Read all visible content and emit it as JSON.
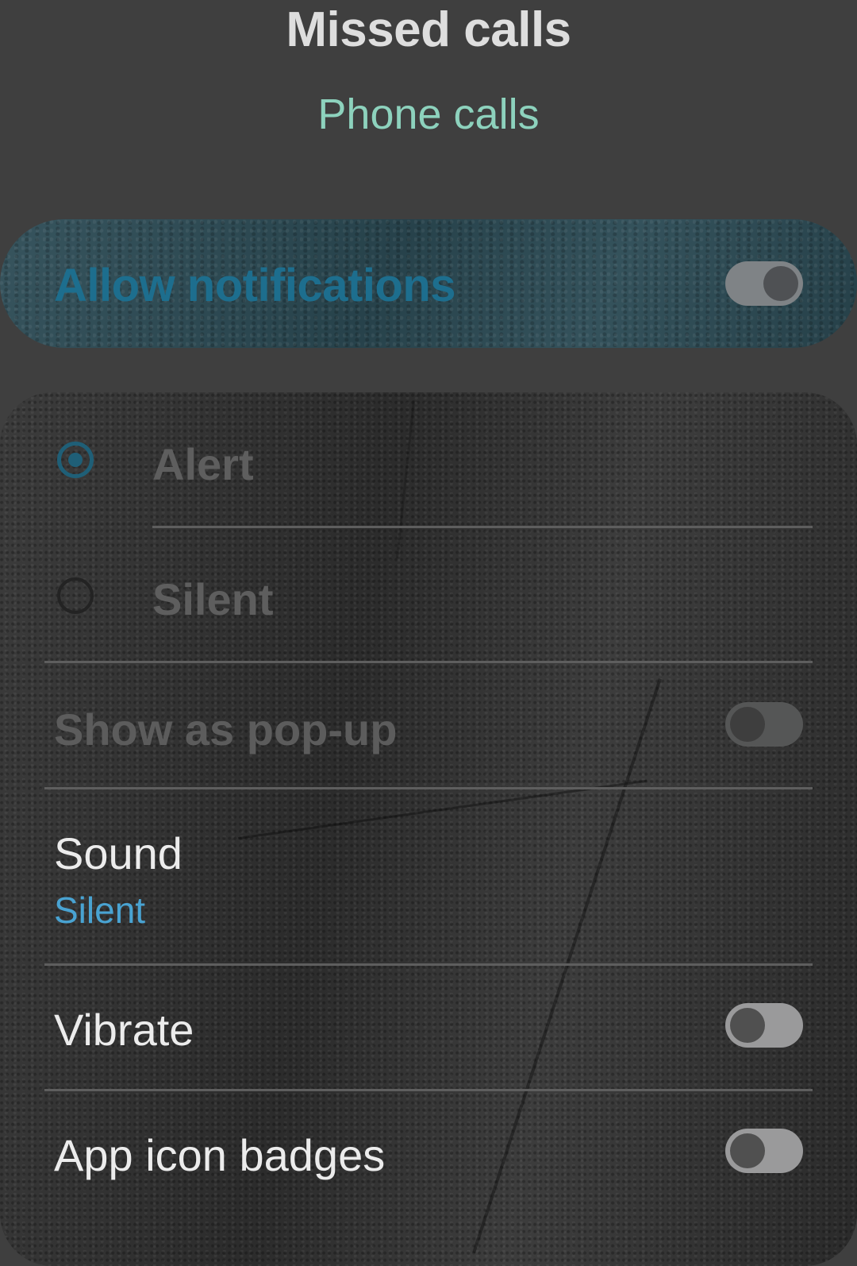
{
  "header": {
    "title": "Missed calls",
    "subtitle": "Phone calls"
  },
  "allow_notifications": {
    "label": "Allow notifications",
    "enabled": true
  },
  "alert_options": [
    {
      "label": "Alert",
      "selected": true
    },
    {
      "label": "Silent",
      "selected": false
    }
  ],
  "settings": {
    "popup": {
      "label": "Show as pop-up",
      "enabled": false,
      "disabled": true
    },
    "sound": {
      "label": "Sound",
      "value": "Silent"
    },
    "vibrate": {
      "label": "Vibrate",
      "enabled": false
    },
    "badges": {
      "label": "App icon badges",
      "enabled": false
    }
  },
  "colors": {
    "accent_teal": "#8dd2bd",
    "accent_blue": "#49a3d2",
    "allow_text": "#1d6e8e",
    "background": "#3f3f3f"
  }
}
